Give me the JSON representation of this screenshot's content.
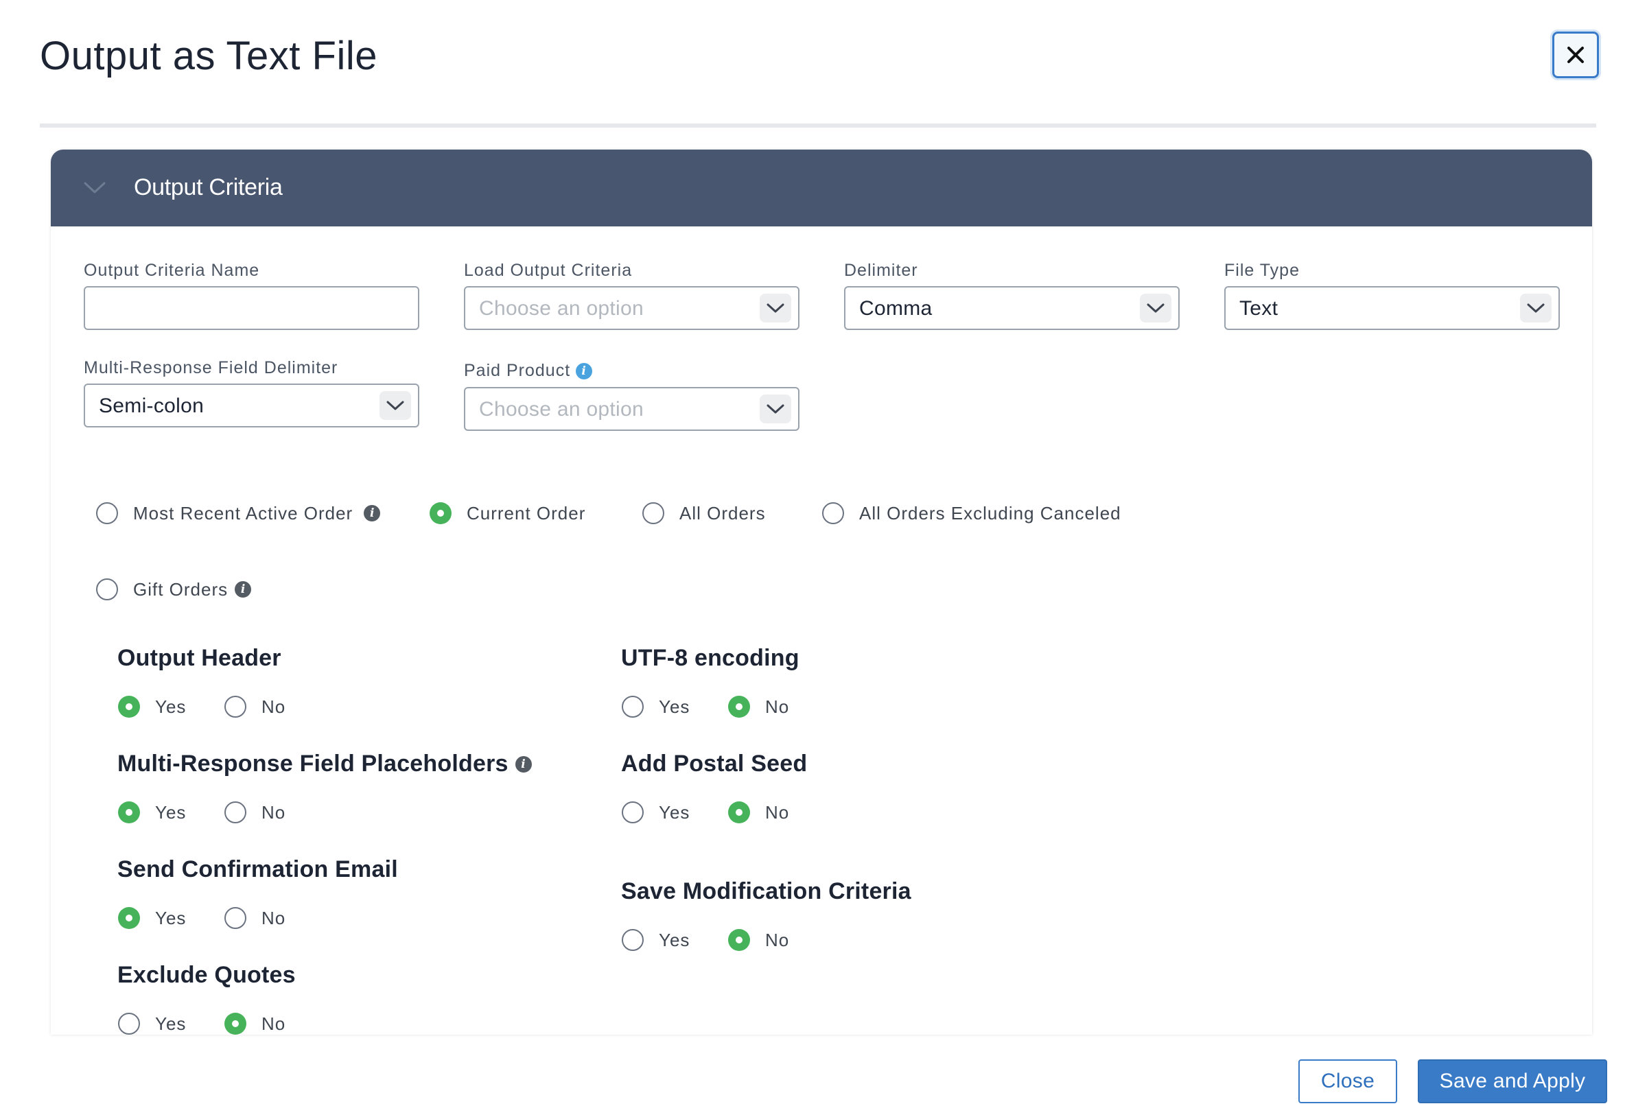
{
  "modal": {
    "title": "Output as Text File",
    "close_icon": "close-icon"
  },
  "panel": {
    "title": "Output Criteria",
    "chevron_icon": "chevron-down-icon",
    "header_color": "#48566f"
  },
  "fields": {
    "output_criteria_name": {
      "label": "Output Criteria Name",
      "value": "",
      "placeholder": ""
    },
    "load_output_criteria": {
      "label": "Load Output Criteria",
      "value": "Choose an option"
    },
    "delimiter": {
      "label": "Delimiter",
      "value": "Comma"
    },
    "file_type": {
      "label": "File Type",
      "value": "Text"
    },
    "multi_response_delimiter": {
      "label": "Multi-Response Field Delimiter",
      "value": "Semi-colon"
    },
    "paid_product": {
      "label": "Paid Product",
      "value": "Choose an option",
      "info_icon": "info-icon"
    }
  },
  "order_scope": {
    "selected": "Current Order",
    "options": [
      {
        "label": "Most Recent Active Order",
        "checked": false,
        "info_icon": "info-icon"
      },
      {
        "label": "Current Order",
        "checked": true
      },
      {
        "label": "All Orders",
        "checked": false
      },
      {
        "label": "All Orders Excluding Canceled",
        "checked": false
      },
      {
        "label": "Gift Orders",
        "checked": false,
        "info_icon": "info-icon"
      }
    ]
  },
  "yes_label": "Yes",
  "no_label": "No",
  "options": {
    "output_header": {
      "title": "Output Header",
      "value": "Yes"
    },
    "multi_response_placeholders": {
      "title": "Multi-Response Field Placeholders",
      "value": "Yes",
      "info_icon": "info-icon"
    },
    "send_confirmation_email": {
      "title": "Send Confirmation Email",
      "value": "Yes"
    },
    "exclude_quotes": {
      "title": "Exclude Quotes",
      "value": "No"
    },
    "utf8_encoding": {
      "title": "UTF-8 encoding",
      "value": "No"
    },
    "add_postal_seed": {
      "title": "Add Postal Seed",
      "value": "No"
    },
    "save_modification_criteria": {
      "title": "Save Modification Criteria",
      "value": "No"
    }
  },
  "footer": {
    "close_label": "Close",
    "save_label": "Save and Apply"
  },
  "colors": {
    "accent": "#3a7bc8",
    "radio_checked": "#46b35a"
  }
}
